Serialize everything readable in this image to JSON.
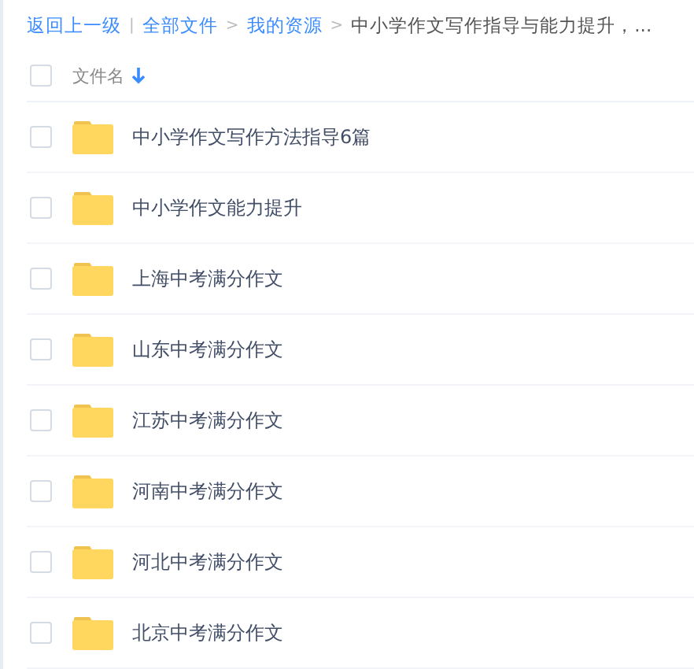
{
  "breadcrumb": [
    {
      "kind": "link",
      "text": "返回上一级"
    },
    {
      "kind": "separator",
      "text": "|"
    },
    {
      "kind": "link",
      "text": "全部文件"
    },
    {
      "kind": "separator",
      "text": ">"
    },
    {
      "kind": "link",
      "text": "我的资源"
    },
    {
      "kind": "separator",
      "text": ">"
    },
    {
      "kind": "current",
      "text": "中小学作文写作指导与能力提升，..."
    }
  ],
  "table": {
    "header": {
      "checked": false,
      "label": "文件名",
      "sorted": true
    },
    "rows": [
      {
        "name": "中小学作文写作方法指导6篇",
        "checked": false
      },
      {
        "name": "中小学作文能力提升",
        "checked": false
      },
      {
        "name": "上海中考满分作文",
        "checked": false
      },
      {
        "name": "山东中考满分作文",
        "checked": false
      },
      {
        "name": "江苏中考满分作文",
        "checked": false
      },
      {
        "name": "河南中考满分作文",
        "checked": false
      },
      {
        "name": "河北中考满分作文",
        "checked": false
      },
      {
        "name": "北京中考满分作文",
        "checked": false
      }
    ]
  }
}
